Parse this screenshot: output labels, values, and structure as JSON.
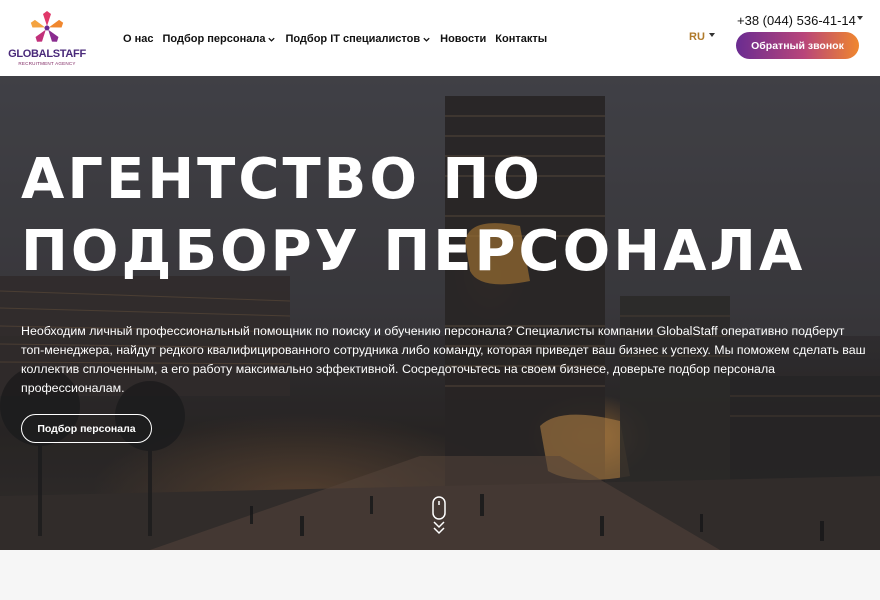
{
  "brand": {
    "name": "GLOBALSTAFF",
    "tagline": "RECRUITMENT AGENCY",
    "colors": {
      "purple": "#6a2c91",
      "magenta": "#b8457a",
      "orange": "#f0872e"
    }
  },
  "nav": {
    "items": [
      {
        "label": "О нас",
        "has_dropdown": false
      },
      {
        "label": "Подбор персонала",
        "has_dropdown": true
      },
      {
        "label": "Подбор IT специалистов",
        "has_dropdown": true
      },
      {
        "label": "Новости",
        "has_dropdown": false
      },
      {
        "label": "Контакты",
        "has_dropdown": false
      }
    ]
  },
  "header": {
    "language": "RU",
    "phone": "+38 (044) 536-41-14",
    "callback_label": "Обратный звонок"
  },
  "hero": {
    "title": "АГЕНТСТВО ПО ПОДБОРУ ПЕРСОНАЛА",
    "text": "Необходим личный профессиональный помощник по поиску и обучению персонала? Специалисты компании GlobalStaff оперативно подберут топ-менеджера, найдут редкого квалифицированного сотрудника либо команду, которая приведет ваш бизнес к успеху. Мы поможем сделать ваш коллектив сплоченным, а его работу максимально эффективной. Сосредоточьтесь на своем бизнесе, доверьте подбор персонала профессионалам.",
    "button_label": "Подбор персонала",
    "scroll_icon": "mouse-scroll-icon"
  }
}
